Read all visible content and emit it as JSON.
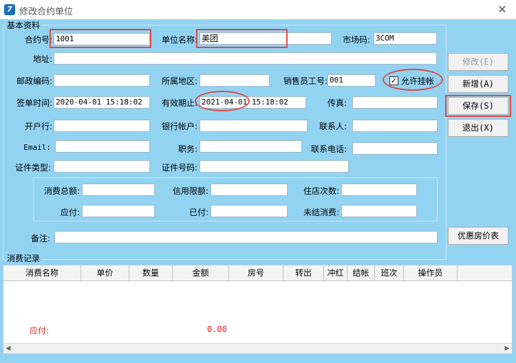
{
  "window": {
    "title": "修改合约单位",
    "close_glyph": "✕",
    "icon_glyph": "7"
  },
  "basic_group": {
    "label": "基本资料"
  },
  "fields": {
    "contract_no": {
      "label": "合约号:",
      "value": "1001"
    },
    "unit_name": {
      "label": "单位名称:",
      "value": "美团"
    },
    "market_code": {
      "label": "市场码:",
      "value": "3COM"
    },
    "address": {
      "label": "地址:",
      "value": ""
    },
    "postal_code": {
      "label": "邮政编码:",
      "value": ""
    },
    "region": {
      "label": "所属地区:",
      "value": ""
    },
    "sales_id": {
      "label": "销售员工号:",
      "value": "001"
    },
    "allow_credit": {
      "label": "允许挂帐",
      "checked": "✓"
    },
    "sign_time": {
      "label": "签单时间:",
      "value": "2020-04-01 15:18:02"
    },
    "valid_until": {
      "label": "有效期止:",
      "value": "2021-04-01 15:18:02"
    },
    "fax": {
      "label": "传真:",
      "value": ""
    },
    "bank": {
      "label": "开户行:",
      "value": ""
    },
    "bank_account": {
      "label": "银行帐户:",
      "value": ""
    },
    "contact": {
      "label": "联系人:",
      "value": ""
    },
    "email": {
      "label": "Email:",
      "value": ""
    },
    "position": {
      "label": "职务:",
      "value": ""
    },
    "contact_phone": {
      "label": "联系电话:",
      "value": ""
    },
    "id_type": {
      "label": "证件类型:",
      "value": ""
    },
    "id_no": {
      "label": "证件号码:",
      "value": ""
    },
    "total_spend": {
      "label": "消费总额:",
      "value": ""
    },
    "credit_limit": {
      "label": "信用限额:",
      "value": ""
    },
    "stay_count": {
      "label": "住店次数:",
      "value": ""
    },
    "payable": {
      "label": "应付:",
      "value": ""
    },
    "paid": {
      "label": "已付:",
      "value": ""
    },
    "unsettled": {
      "label": "未结消费:",
      "value": ""
    },
    "remark": {
      "label": "备注:",
      "value": ""
    }
  },
  "buttons": {
    "modify": "修改(E)",
    "add": "新增(A)",
    "save": "保存(S)",
    "exit": "退出(X)",
    "discount": "优惠房价表"
  },
  "records": {
    "label": "消费记录",
    "columns": [
      "消费名称",
      "单价",
      "数量",
      "金额",
      "房号",
      "转出",
      "冲红",
      "结帐",
      "班次",
      "操作员"
    ],
    "summary_label": "应付:",
    "summary_value": "0.00"
  },
  "colors": {
    "background": "#93d3f2",
    "highlight": "#e04848",
    "summary": "#e02020"
  }
}
